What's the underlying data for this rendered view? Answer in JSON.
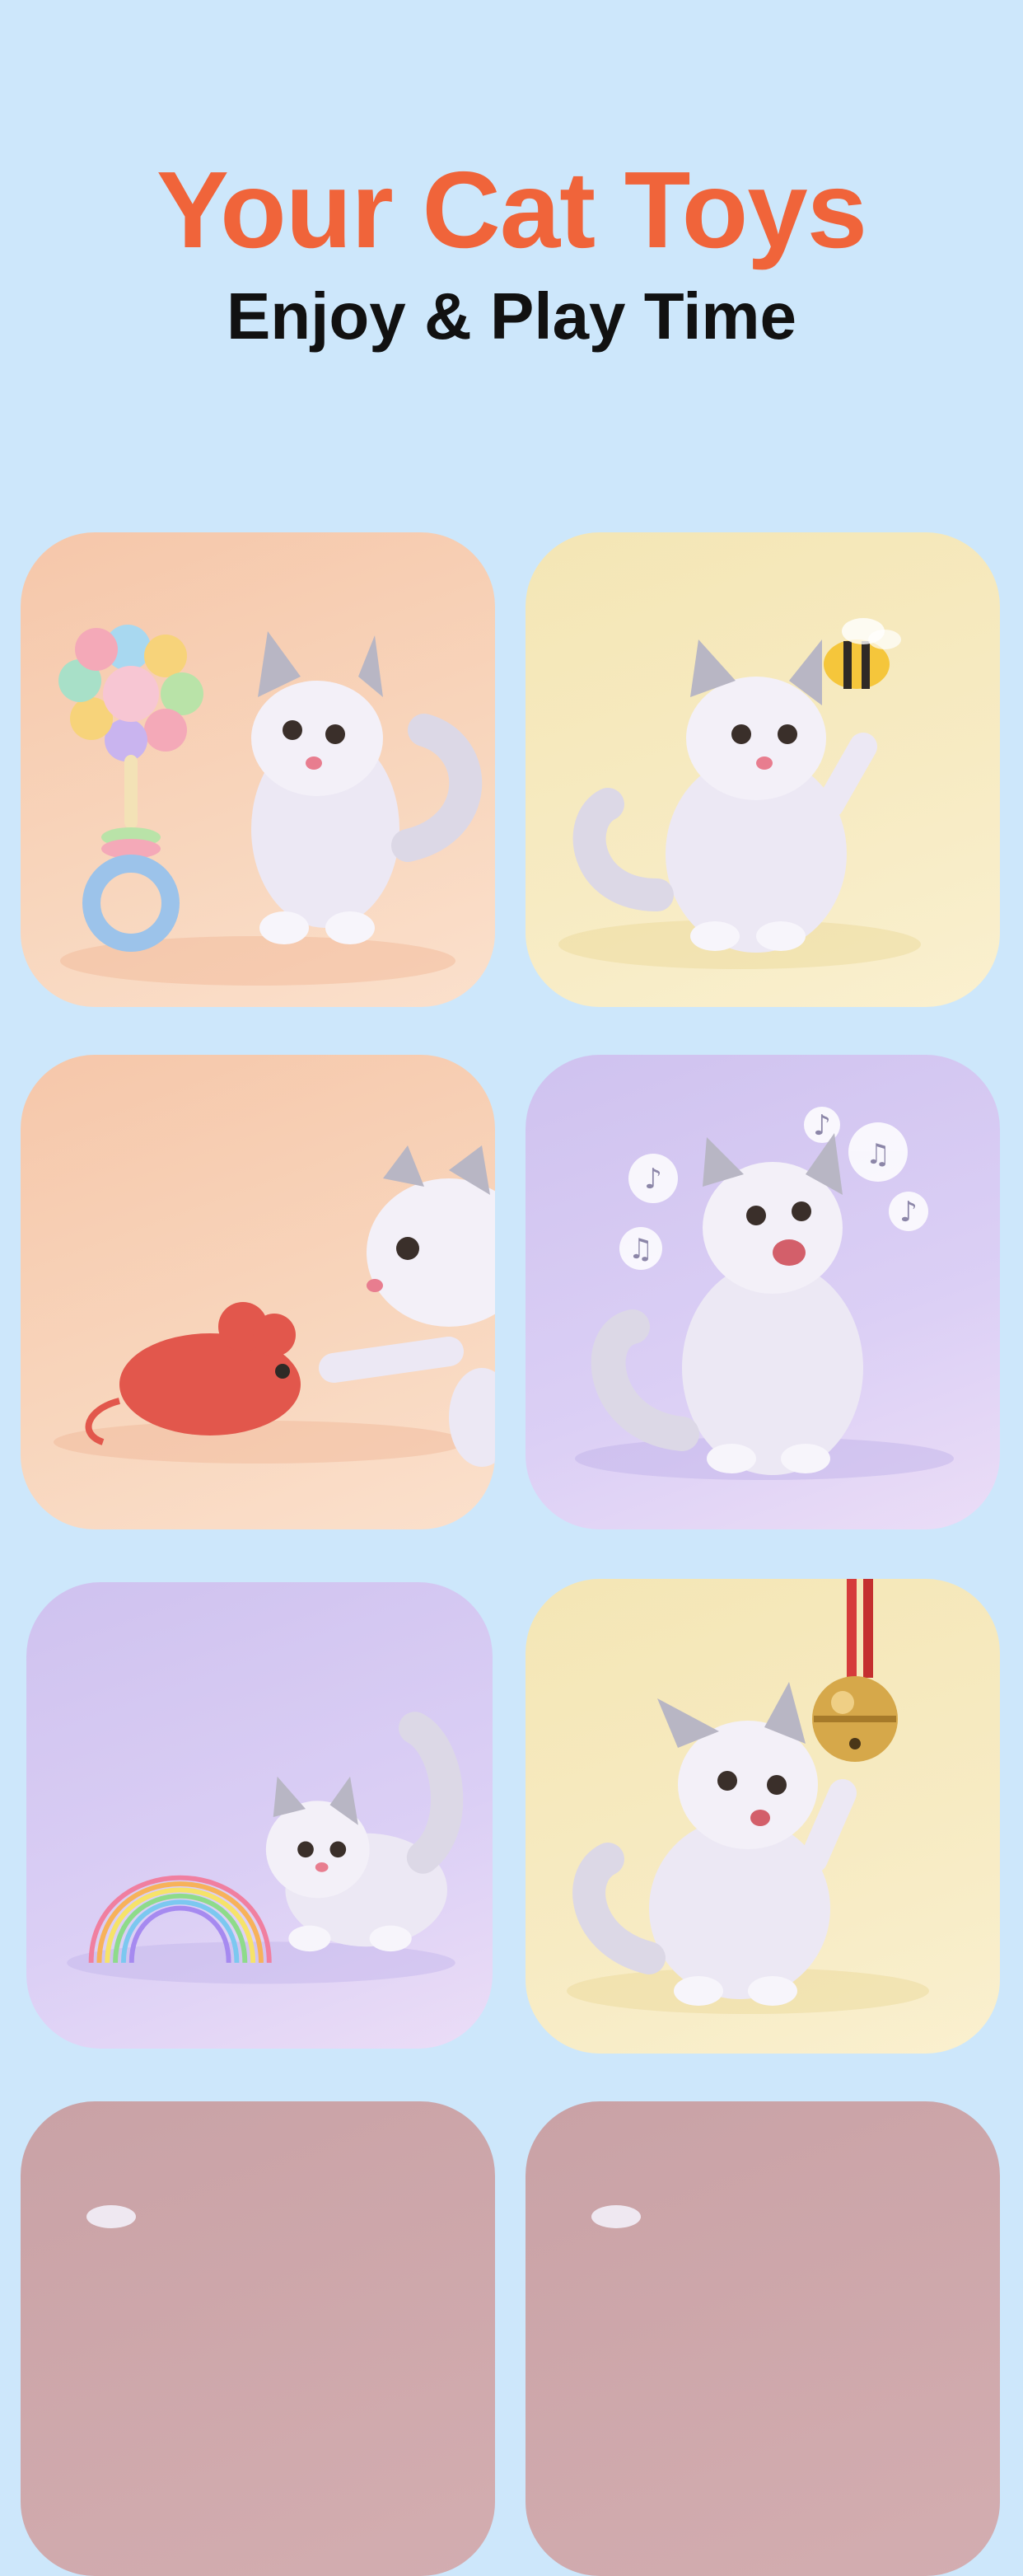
{
  "header": {
    "title": "Your Cat Toys",
    "subtitle": "Enjoy & Play Time"
  },
  "colors": {
    "background": "#cde7fb",
    "title": "#f0643a",
    "subtitle": "#111111",
    "card_peach": "#f7cdb2",
    "card_yellow": "#f6e9bf",
    "card_purple": "#d7caf2",
    "card_rose": "#cca6a9"
  },
  "cards": [
    {
      "toy": "rattle-toy-icon",
      "scene": "cat with pastel rattle"
    },
    {
      "toy": "bee-toy-icon",
      "scene": "cat reaching for bee"
    },
    {
      "toy": "mouse-toy-icon",
      "scene": "cat pawing red mouse"
    },
    {
      "toy": "music-notes-icon",
      "scene": "cat singing with music notes"
    },
    {
      "toy": "spring-toy-icon",
      "scene": "cat with rainbow spring"
    },
    {
      "toy": "bell-toy-icon",
      "scene": "cat reaching for bell"
    },
    {
      "toy": "cat-icon",
      "scene": "partially visible card"
    },
    {
      "toy": "cat-icon",
      "scene": "partially visible card"
    }
  ]
}
